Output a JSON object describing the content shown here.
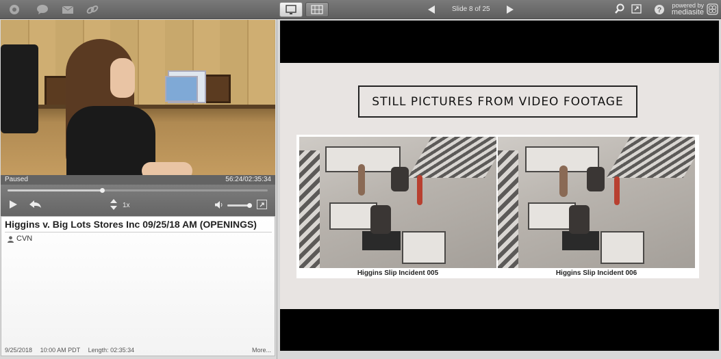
{
  "toolbar": {
    "icons": [
      "dashboard-icon",
      "chat-icon",
      "mail-icon",
      "link-icon"
    ],
    "slide_counter": "Slide 8 of 25",
    "powered_line1": "powered by",
    "powered_line2": "mediasite"
  },
  "player": {
    "status": "Paused",
    "time": "56:24/02:35:34",
    "speed": "1x",
    "progress": 0.363,
    "volume": 0.9
  },
  "presentation": {
    "title": "Higgins v. Big Lots Stores Inc 09/25/18 AM (OPENINGS)",
    "presenter": "CVN",
    "date": "9/25/2018",
    "time": "10:00 AM PDT",
    "length": "Length: 02:35:34",
    "more": "More..."
  },
  "slide": {
    "title": "STILL PICTURES FROM VIDEO FOOTAGE",
    "captions": [
      "Higgins Slip Incident 005",
      "Higgins Slip Incident 006"
    ]
  }
}
